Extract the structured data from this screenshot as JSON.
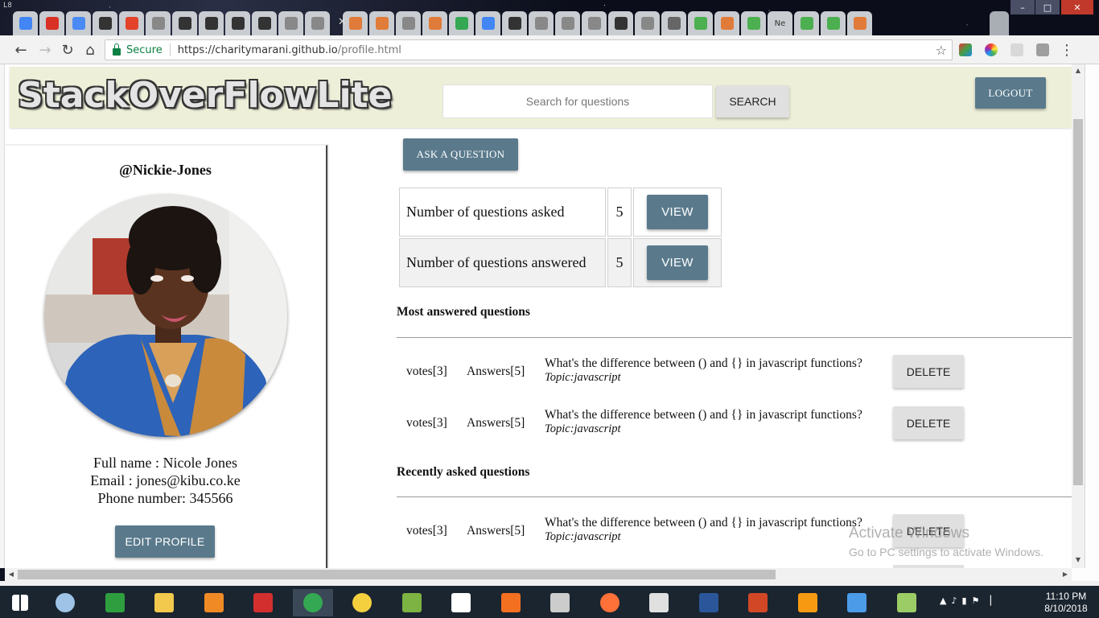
{
  "browser": {
    "url_secure_label": "Secure",
    "url_host": "https://charitymarani.github.io",
    "url_path": "/profile.html",
    "tabs": [
      {
        "icon": "google-ads-icon",
        "color": "#4285f4"
      },
      {
        "icon": "gmail-icon",
        "color": "#d93025"
      },
      {
        "icon": "docs-icon",
        "color": "#4a8af4"
      },
      {
        "icon": "github-icon",
        "color": "#333333"
      },
      {
        "icon": "gitlab-icon",
        "color": "#e24329"
      },
      {
        "icon": "file-icon",
        "color": "#888888"
      },
      {
        "icon": "github-icon",
        "color": "#333333"
      },
      {
        "icon": "github-icon",
        "color": "#333333"
      },
      {
        "icon": "github-icon",
        "color": "#333333"
      },
      {
        "icon": "github-icon",
        "color": "#333333"
      },
      {
        "icon": "file-icon",
        "color": "#888888"
      },
      {
        "icon": "file-icon",
        "color": "#888888"
      },
      {
        "icon": "swagger-icon",
        "color": "#e07b39"
      },
      {
        "icon": "swagger-icon",
        "color": "#e07b39"
      },
      {
        "icon": "file-icon",
        "color": "#888888"
      },
      {
        "icon": "swagger-icon",
        "color": "#e07b39"
      },
      {
        "icon": "chrome-icon",
        "color": "#34a853"
      },
      {
        "icon": "google-icon",
        "color": "#4285f4"
      },
      {
        "icon": "github-icon",
        "color": "#333333"
      },
      {
        "icon": "file-icon",
        "color": "#888888"
      },
      {
        "icon": "file-icon",
        "color": "#888888"
      },
      {
        "icon": "file-icon",
        "color": "#888888"
      },
      {
        "icon": "github-icon",
        "color": "#333333"
      },
      {
        "icon": "file-icon",
        "color": "#888888"
      },
      {
        "icon": "text-icon",
        "color": "#666666"
      },
      {
        "icon": "w3-icon",
        "color": "#4caf50"
      },
      {
        "icon": "swagger-icon",
        "color": "#e07b39"
      },
      {
        "icon": "w3-icon",
        "color": "#4caf50"
      },
      {
        "icon": "new-tab-label",
        "color": "#cccccc",
        "text": "Ne"
      },
      {
        "icon": "w3-icon",
        "color": "#4caf50"
      },
      {
        "icon": "w3-icon",
        "color": "#4caf50"
      },
      {
        "icon": "swagger-icon",
        "color": "#e07b39"
      }
    ]
  },
  "site": {
    "logo": "StackOverFlowLite",
    "search_placeholder": "Search for questions",
    "search_button": "SEARCH",
    "logout_button": "LOGOUT",
    "accent_color": "#5a7a8c",
    "navbar_color": "#eeefd8"
  },
  "profile": {
    "username": "@Nickie-Jones",
    "full_name": "Full name : Nicole Jones",
    "email": "Email : jones@kibu.co.ke",
    "phone": "Phone number: 345566",
    "edit_button": "EDIT PROFILE"
  },
  "main": {
    "ask_button": "ASK A QUESTION",
    "stats": [
      {
        "label": "Number of questions asked",
        "count": "5",
        "button": "VIEW"
      },
      {
        "label": "Number of questions answered",
        "count": "5",
        "button": "VIEW"
      }
    ],
    "most_answered_title": "Most answered questions",
    "most_answered": [
      {
        "votes": "votes[3]",
        "answers": "Answers[5]",
        "title": "What's the difference between () and {} in javascript functions?",
        "topic": "Topic:javascript",
        "button": "DELETE"
      },
      {
        "votes": "votes[3]",
        "answers": "Answers[5]",
        "title": "What's the difference between () and {} in javascript functions?",
        "topic": "Topic:javascript",
        "button": "DELETE"
      }
    ],
    "recent_title": "Recently asked questions",
    "recent": [
      {
        "votes": "votes[3]",
        "answers": "Answers[5]",
        "title": "What's the difference between () and {} in javascript functions?",
        "topic": "Topic:javascript",
        "button": "DELETE"
      }
    ]
  },
  "watermark": {
    "line1": "Activate Windows",
    "line2": "Go to PC settings to activate Windows."
  },
  "taskbar": {
    "time": "11:10 PM",
    "date": "8/10/2018",
    "apps": [
      {
        "icon": "start-icon",
        "color": "#ffffff"
      },
      {
        "icon": "network-icon",
        "color": "#9ec3e6"
      },
      {
        "icon": "store-icon",
        "color": "#2e9e3e"
      },
      {
        "icon": "file-explorer-icon",
        "color": "#f2c94c"
      },
      {
        "icon": "vlc-icon",
        "color": "#f08a24"
      },
      {
        "icon": "acrobat-icon",
        "color": "#d32f2f"
      },
      {
        "icon": "chrome-icon",
        "color": "#34a853"
      },
      {
        "icon": "ok-app-icon",
        "color": "#f4d03f"
      },
      {
        "icon": "android-studio-icon",
        "color": "#7cb342"
      },
      {
        "icon": "blank-file-icon",
        "color": "#ffffff"
      },
      {
        "icon": "xampp-icon",
        "color": "#f37021"
      },
      {
        "icon": "spider-icon",
        "color": "#cccccc"
      },
      {
        "icon": "firefox-icon",
        "color": "#ff7139"
      },
      {
        "icon": "sketch-icon",
        "color": "#e0e0e0"
      },
      {
        "icon": "word-icon",
        "color": "#2b579a"
      },
      {
        "icon": "powerpoint-icon",
        "color": "#d24726"
      },
      {
        "icon": "sublime-icon",
        "color": "#f79a12"
      },
      {
        "icon": "git-gui-icon",
        "color": "#4c9be8"
      },
      {
        "icon": "notepad-icon",
        "color": "#9ccc65"
      }
    ]
  }
}
